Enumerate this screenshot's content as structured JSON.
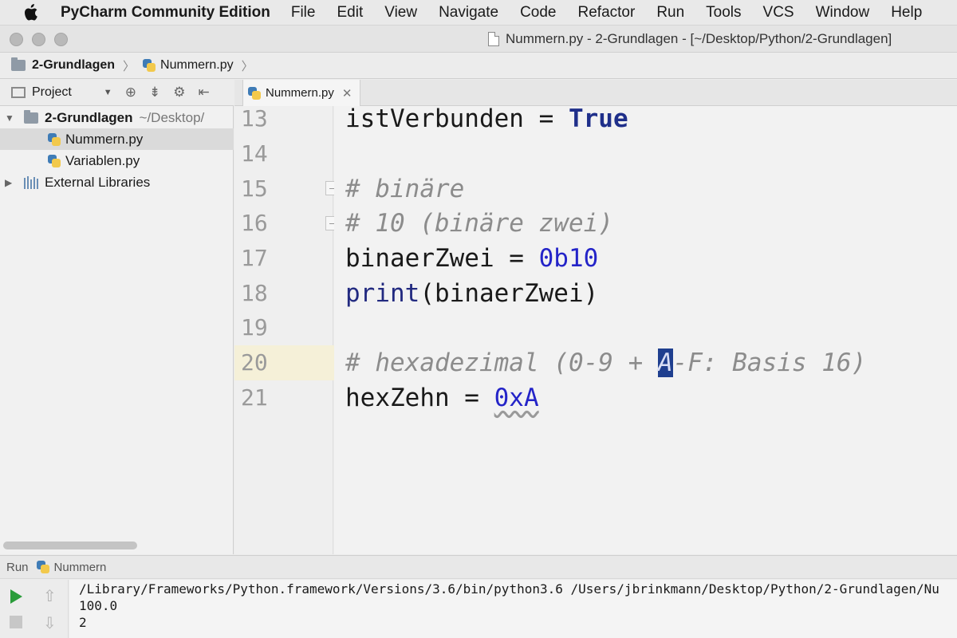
{
  "menubar": {
    "app_name": "PyCharm Community Edition",
    "items": [
      "File",
      "Edit",
      "View",
      "Navigate",
      "Code",
      "Refactor",
      "Run",
      "Tools",
      "VCS",
      "Window",
      "Help"
    ]
  },
  "window": {
    "title": "Nummern.py - 2-Grundlagen - [~/Desktop/Python/2-Grundlagen]"
  },
  "navbar": {
    "crumbs": [
      "2-Grundlagen",
      "Nummern.py"
    ]
  },
  "project": {
    "header_label": "Project",
    "root": {
      "name": "2-Grundlagen",
      "path": "~/Desktop/"
    },
    "files": [
      "Nummern.py",
      "Variablen.py"
    ],
    "libraries": "External Libraries"
  },
  "editor": {
    "tab_label": "Nummern.py",
    "lines": [
      {
        "num": "13",
        "text": "istVerbunden = True"
      },
      {
        "num": "14",
        "text": ""
      },
      {
        "num": "15",
        "text": "# binäre"
      },
      {
        "num": "16",
        "text": "# 10 (binäre zwei)"
      },
      {
        "num": "17",
        "text": "binaerZwei = 0b10"
      },
      {
        "num": "18",
        "text": "print(binaerZwei)"
      },
      {
        "num": "19",
        "text": ""
      },
      {
        "num": "20",
        "text": "# hexadezimal (0-9 + A-F: Basis 16)"
      },
      {
        "num": "21",
        "text": "hexZehn = 0xA"
      }
    ],
    "tokens": {
      "l13_var": "istVerbunden = ",
      "l13_kw": "True",
      "l15": "# binäre",
      "l16": "# 10 (binäre zwei)",
      "l17_var": "binaerZwei = ",
      "l17_num": "0b10",
      "l18_fn": "print",
      "l18_rest": "(binaerZwei)",
      "l20_a": "# hexadezimal (0-9 + ",
      "l20_sel": "A",
      "l20_b": "-F: Basis 16)",
      "l21_var": "hexZehn = ",
      "l21_num": "0xA"
    }
  },
  "run": {
    "label": "Run",
    "config": "Nummern",
    "output": [
      "/Library/Frameworks/Python.framework/Versions/3.6/bin/python3.6 /Users/jbrinkmann/Desktop/Python/2-Grundlagen/Nu",
      "100.0",
      "2"
    ]
  }
}
